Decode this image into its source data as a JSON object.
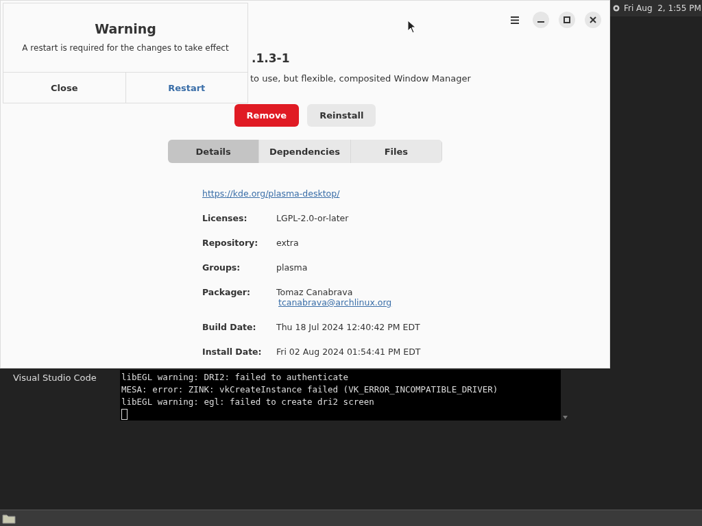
{
  "top_bar": {
    "clock": "Fri Aug  2, 1:55 PM"
  },
  "package_window": {
    "title_fragment": ".1.3-1",
    "description_fragment": "to use, but flexible, composited Window Manager",
    "actions": [
      {
        "label": "Remove",
        "kind": "destructive"
      },
      {
        "label": "Reinstall",
        "kind": "normal"
      }
    ],
    "tabs": [
      {
        "label": "Details",
        "selected": true
      },
      {
        "label": "Dependencies",
        "selected": false
      },
      {
        "label": "Files",
        "selected": false
      }
    ],
    "url": "https://kde.org/plasma-desktop/",
    "details": [
      {
        "label": "Licenses:",
        "value": "LGPL-2.0-or-later"
      },
      {
        "label": "Repository:",
        "value": "extra"
      },
      {
        "label": "Groups:",
        "value": "plasma"
      },
      {
        "label": "Packager:",
        "value": "Tomaz Canabrava",
        "link": "tcanabrava@archlinux.org"
      },
      {
        "label": "Build Date:",
        "value": "Thu 18 Jul 2024 12:40:42 PM EDT"
      },
      {
        "label": "Install Date:",
        "value": "Fri 02 Aug 2024 01:54:41 PM EDT"
      }
    ]
  },
  "dialog": {
    "title": "Warning",
    "message": "A restart is required for the changes to take effect",
    "buttons": [
      {
        "label": "Close",
        "kind": "normal"
      },
      {
        "label": "Restart",
        "kind": "suggested"
      }
    ]
  },
  "desktop_label": "Visual Studio Code",
  "terminal": {
    "lines": [
      "libEGL warning: DRI2: failed to authenticate",
      "MESA: error: ZINK: vkCreateInstance failed (VK_ERROR_INCOMPATIBLE_DRIVER)",
      "libEGL warning: egl: failed to create dri2 screen"
    ]
  }
}
